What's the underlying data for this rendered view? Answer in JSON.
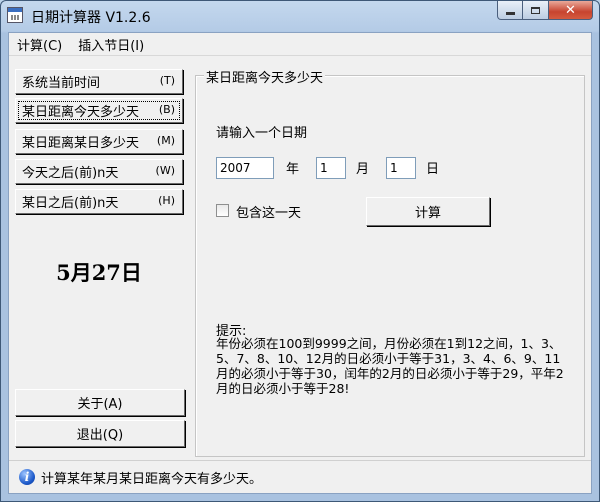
{
  "window": {
    "title": "日期计算器  V1.2.6"
  },
  "titlebar_buttons": {
    "close_glyph": "✕"
  },
  "menu": [
    {
      "label": "计算(C)"
    },
    {
      "label": "插入节日(I)"
    }
  ],
  "nav": [
    {
      "label": "系统当前时间",
      "key": "(T)"
    },
    {
      "label": "某日距离今天多少天",
      "key": "(B)"
    },
    {
      "label": "某日距离某日多少天",
      "key": "(M)"
    },
    {
      "label": "今天之后(前)n天",
      "key": "(W)"
    },
    {
      "label": "某日之后(前)n天",
      "key": "(H)"
    }
  ],
  "date_display": "5月27日",
  "bottom_buttons": {
    "about": "关于(A)",
    "exit": "退出(Q)"
  },
  "panel": {
    "title": "某日距离今天多少天",
    "prompt": "请输入一个日期",
    "year_value": "2007",
    "year_unit": "年",
    "month_value": "1",
    "month_unit": "月",
    "day_value": "1",
    "day_unit": "日",
    "include_day_label": "包含这一天",
    "include_day_checked": false,
    "calculate_button": "计算",
    "hint_title": "提示:",
    "hint_body": "年份必须在100到9999之间，月份必须在1到12之间，1、3、5、7、8、10、12月的日必须小于等于31，3、4、6、9、11月的必须小于等于30，闰年的2月的日必须小于等于29，平年2月的日必须小于等于28!"
  },
  "status": {
    "text": "计算某年某月某日距离今天有多少天。"
  }
}
